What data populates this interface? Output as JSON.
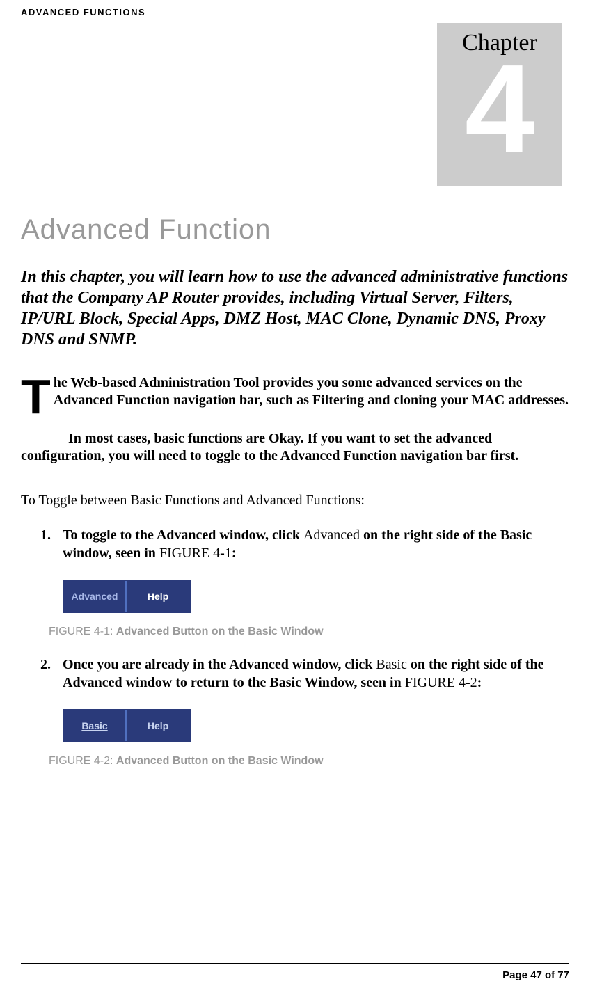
{
  "header": "ADVANCED FUNCTIONS",
  "chapter": {
    "label": "Chapter",
    "number": "4"
  },
  "title": "Advanced Function",
  "intro": "In this chapter, you will learn how to use the advanced administrative functions that the Company AP Router provides, including Virtual Server, Filters, IP/URL Block, Special Apps, DMZ Host, MAC Clone, Dynamic DNS, Proxy DNS and SNMP.",
  "dropcap": "T",
  "paragraph1": "he Web-based Administration Tool provides you some advanced services on the Advanced Function navigation bar, such as Filtering and cloning your MAC addresses.",
  "paragraph2": "In most cases, basic functions are Okay. If you want to set the advanced configuration, you will need to toggle to the Advanced Function navigation bar first.",
  "toggle_heading": "To Toggle between Basic Functions and Advanced Functions:",
  "steps": [
    {
      "num": "1.",
      "bold_a": "To toggle to the Advanced window, click ",
      "normal_a": "Advanced",
      "bold_b": " on the right side of the Basic window, seen in ",
      "normal_b": "FIGURE 4-1",
      "bold_c": ":"
    },
    {
      "num": "2.",
      "bold_a": "Once you are already in the Advanced window, click ",
      "normal_a": "Basic",
      "bold_b": " on the right side of the Advanced window to return to the Basic Window, seen in ",
      "normal_b": "FIGURE 4-2",
      "bold_c": ":"
    }
  ],
  "figures": [
    {
      "buttons": [
        "Advanced",
        "Help"
      ],
      "caption_label": "FIGURE 4-1: ",
      "caption_text": "Advanced Button on the Basic Window"
    },
    {
      "buttons": [
        "Basic",
        "Help"
      ],
      "caption_label": "FIGURE 4-2: ",
      "caption_text": "Advanced Button on the Basic Window"
    }
  ],
  "footer": "Page 47 of 77"
}
